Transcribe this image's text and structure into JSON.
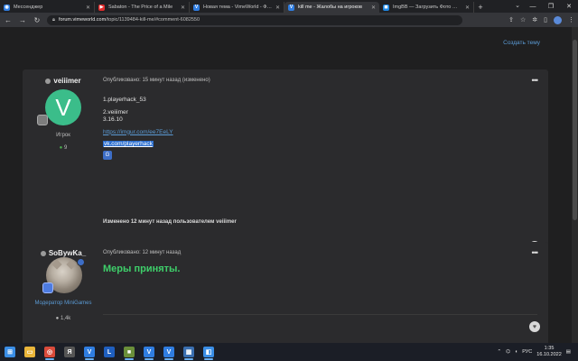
{
  "browser": {
    "tabs": [
      {
        "title": "Мессенджер",
        "color": "#2f7de1",
        "glyph": "◉",
        "active": false
      },
      {
        "title": "Sabaton - The Price of a Mile",
        "color": "#e02b2b",
        "glyph": "▶",
        "active": false
      },
      {
        "title": "Новая тема - VimeWorld - Форум",
        "color": "#2f7de1",
        "glyph": "V",
        "active": false
      },
      {
        "title": "kill me - Жалобы на игроков",
        "color": "#2f7de1",
        "glyph": "V",
        "active": true
      },
      {
        "title": "ImgBB — Загрузить Фото — ЗАГ",
        "color": "#1e88e5",
        "glyph": "◼",
        "active": false
      }
    ],
    "new_tab": "+",
    "url_host": "forum.vimeworld.com",
    "url_path": "/topic/1139484-kill-me/#comment-6082550"
  },
  "page": {
    "create_topic": "Создать тему",
    "post1": {
      "author": "veiiimer",
      "avatar_letter": "V",
      "rank": "Игрок",
      "reputation": "9",
      "meta": "Опубликовано: 15 минут назад (изменено)",
      "more": "•••",
      "lines": [
        "1.playerhack_53",
        "2.veiiimer",
        "3.16.10"
      ],
      "link": "https://imgur.com/ee7EeLY",
      "selected_link": "vk.com/playerhack",
      "edited": "Изменено 12 минут назад пользователем veiiimer"
    },
    "post2": {
      "author": "SoBywKa_",
      "rank": "Модератор MiniGames",
      "reputation": "1,4k",
      "meta": "Опубликовано: 12 минут назад",
      "more": "•••",
      "content": "Меры приняты."
    }
  },
  "taskbar": {
    "items": [
      {
        "name": "start-icon",
        "color": "#3a8ee6",
        "glyph": "⊞"
      },
      {
        "name": "explorer-icon",
        "color": "#e9b53a",
        "glyph": "▭"
      },
      {
        "name": "chrome-icon",
        "color": "#d94b3b",
        "glyph": "◎"
      },
      {
        "name": "yandex-icon",
        "color": "#555555",
        "glyph": "Я"
      },
      {
        "name": "vime-icon",
        "color": "#2f7de1",
        "glyph": "V"
      },
      {
        "name": "launcher-icon",
        "color": "#1f5fbf",
        "glyph": "L"
      },
      {
        "name": "minecraft-icon",
        "color": "#6a8f3a",
        "glyph": "■"
      },
      {
        "name": "vime-icon-2",
        "color": "#2f7de1",
        "glyph": "V"
      },
      {
        "name": "vime-icon-3",
        "color": "#2f7de1",
        "glyph": "V"
      },
      {
        "name": "photos-icon",
        "color": "#3a6fb0",
        "glyph": "▦"
      },
      {
        "name": "app-icon",
        "color": "#3a8ee6",
        "glyph": "◧"
      }
    ],
    "lang": "РУС",
    "time": "1:35",
    "date": "16.10.2022"
  }
}
